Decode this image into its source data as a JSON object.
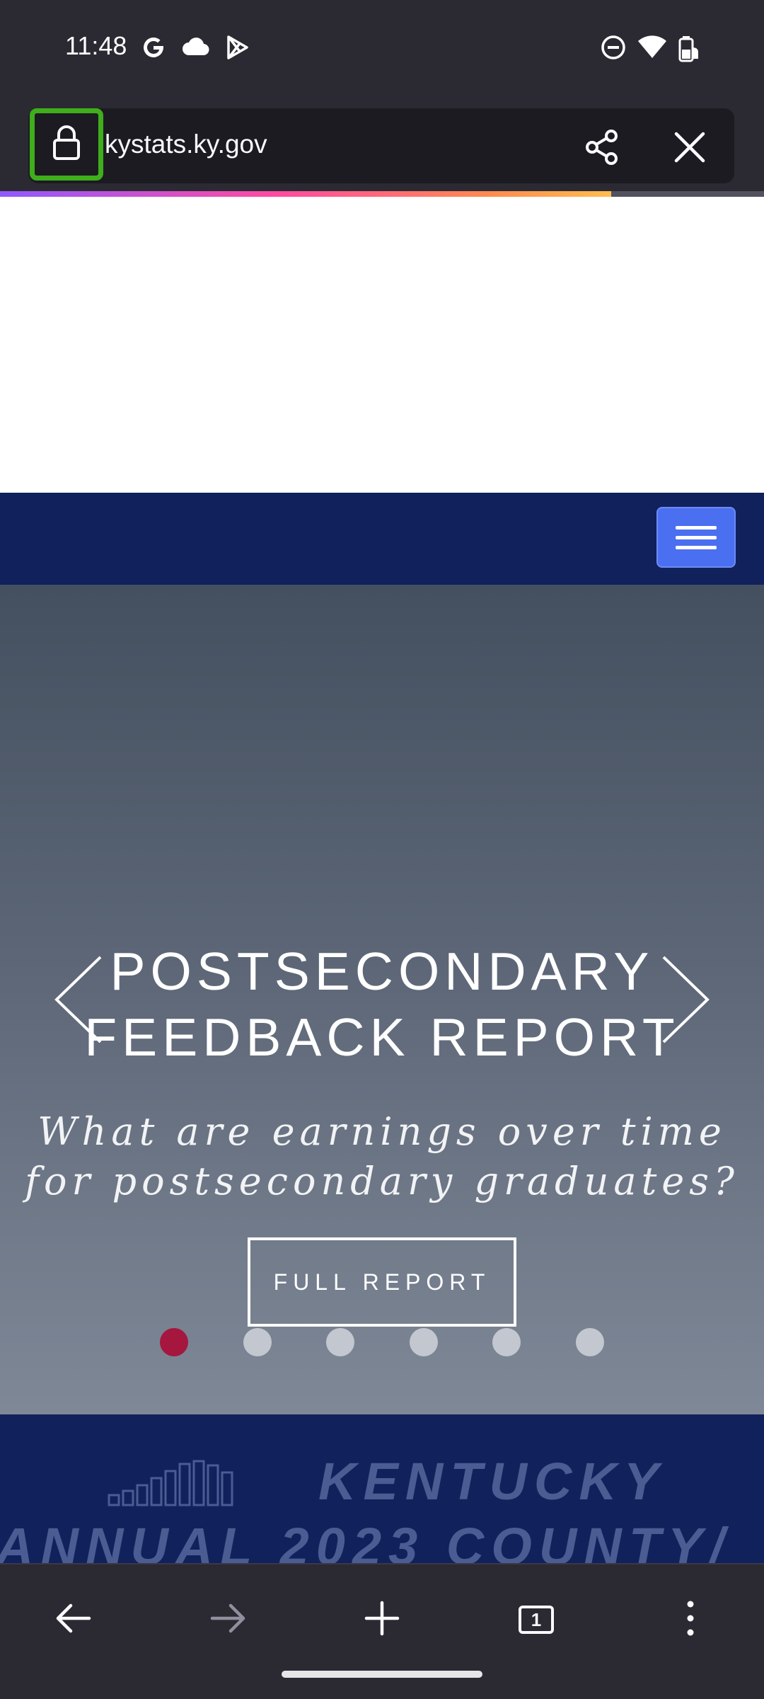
{
  "status_bar": {
    "time": "11:48",
    "left_icons": [
      "google-icon",
      "cloud-icon",
      "play-store-icon"
    ],
    "right_icons": [
      "do-not-disturb-icon",
      "wifi-icon",
      "battery-icon"
    ]
  },
  "url_bar": {
    "url": "kystats.ky.gov",
    "lock_icon": "lock-icon",
    "share_icon": "share-icon",
    "close_icon": "close-icon"
  },
  "page_load_progress": 0.8,
  "colors": {
    "navbar": "#10215c",
    "hamburger": "#4a6ff0",
    "active_dot": "#a5173f",
    "highlight": "#3fae1b"
  },
  "hero": {
    "title_line1": "POSTSECONDARY",
    "title_line2": "FEEDBACK REPORT",
    "subtitle_line1": "What are earnings over time",
    "subtitle_line2": "for postsecondary graduates?",
    "button_label": "FULL REPORT",
    "slide_count": 6,
    "active_slide": 1
  },
  "banner": {
    "line1": "KENTUCKY",
    "line2": "ANNUAL 2023 COUNTY/"
  },
  "toolbar": {
    "tab_count": "1",
    "icons": [
      "back-icon",
      "forward-icon",
      "new-tab-icon",
      "tabs-icon",
      "menu-icon"
    ]
  }
}
